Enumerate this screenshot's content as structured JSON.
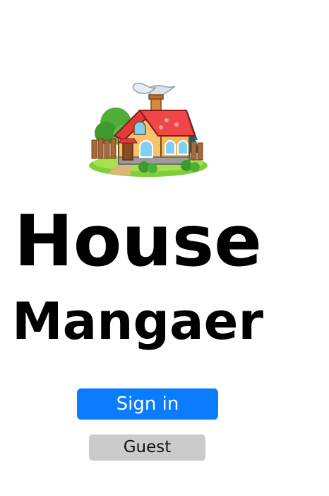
{
  "app": {
    "title_line1": "House",
    "title_line2": "Mangaer"
  },
  "logo": {
    "icon": "house-icon"
  },
  "actions": {
    "signin_label": "Sign in",
    "guest_label": "Guest"
  },
  "colors": {
    "primary_button": "#0a7cff",
    "secondary_button": "#cbcbcb",
    "roof": "#e23b3b",
    "wall": "#f6c46a"
  }
}
